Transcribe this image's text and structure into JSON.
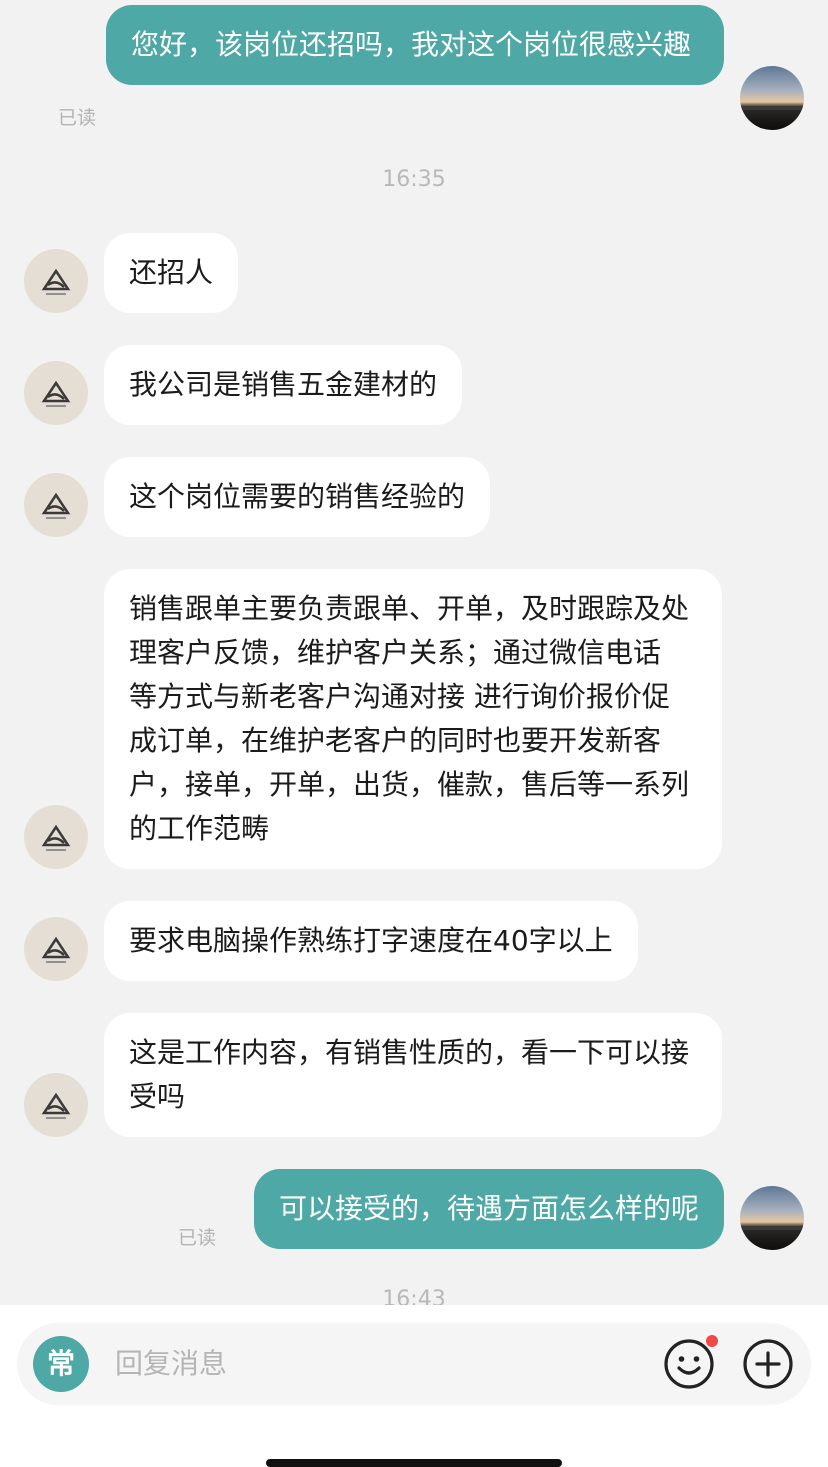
{
  "messages": {
    "m1": "您好，该岗位还招吗，我对这个岗位很感兴趣",
    "m1_status": "已读",
    "time1": "16:35",
    "m2": "还招人",
    "m3": "我公司是销售五金建材的",
    "m4": "这个岗位需要的销售经验的",
    "m5": "销售跟单主要负责跟单、开单，及时跟踪及处理客户反馈，维护客户关系；通过微信电话 等方式与新老客户沟通对接 进行询价报价促成订单，在维护老客户的同时也要开发新客户，接单，开单，出货，催款，售后等一系列的工作范畴",
    "m6": "要求电脑操作熟练打字速度在40字以上",
    "m7": "这是工作内容，有销售性质的，看一下可以接受吗",
    "m8": "可以接受的，待遇方面怎么样的呢",
    "m8_status": "已读",
    "time2": "16:43"
  },
  "input": {
    "quick_reply_label": "常",
    "placeholder": "回复消息"
  },
  "colors": {
    "accent": "#4ea8a5",
    "background": "#f2f2f2",
    "notification_dot": "#ef4a48"
  }
}
